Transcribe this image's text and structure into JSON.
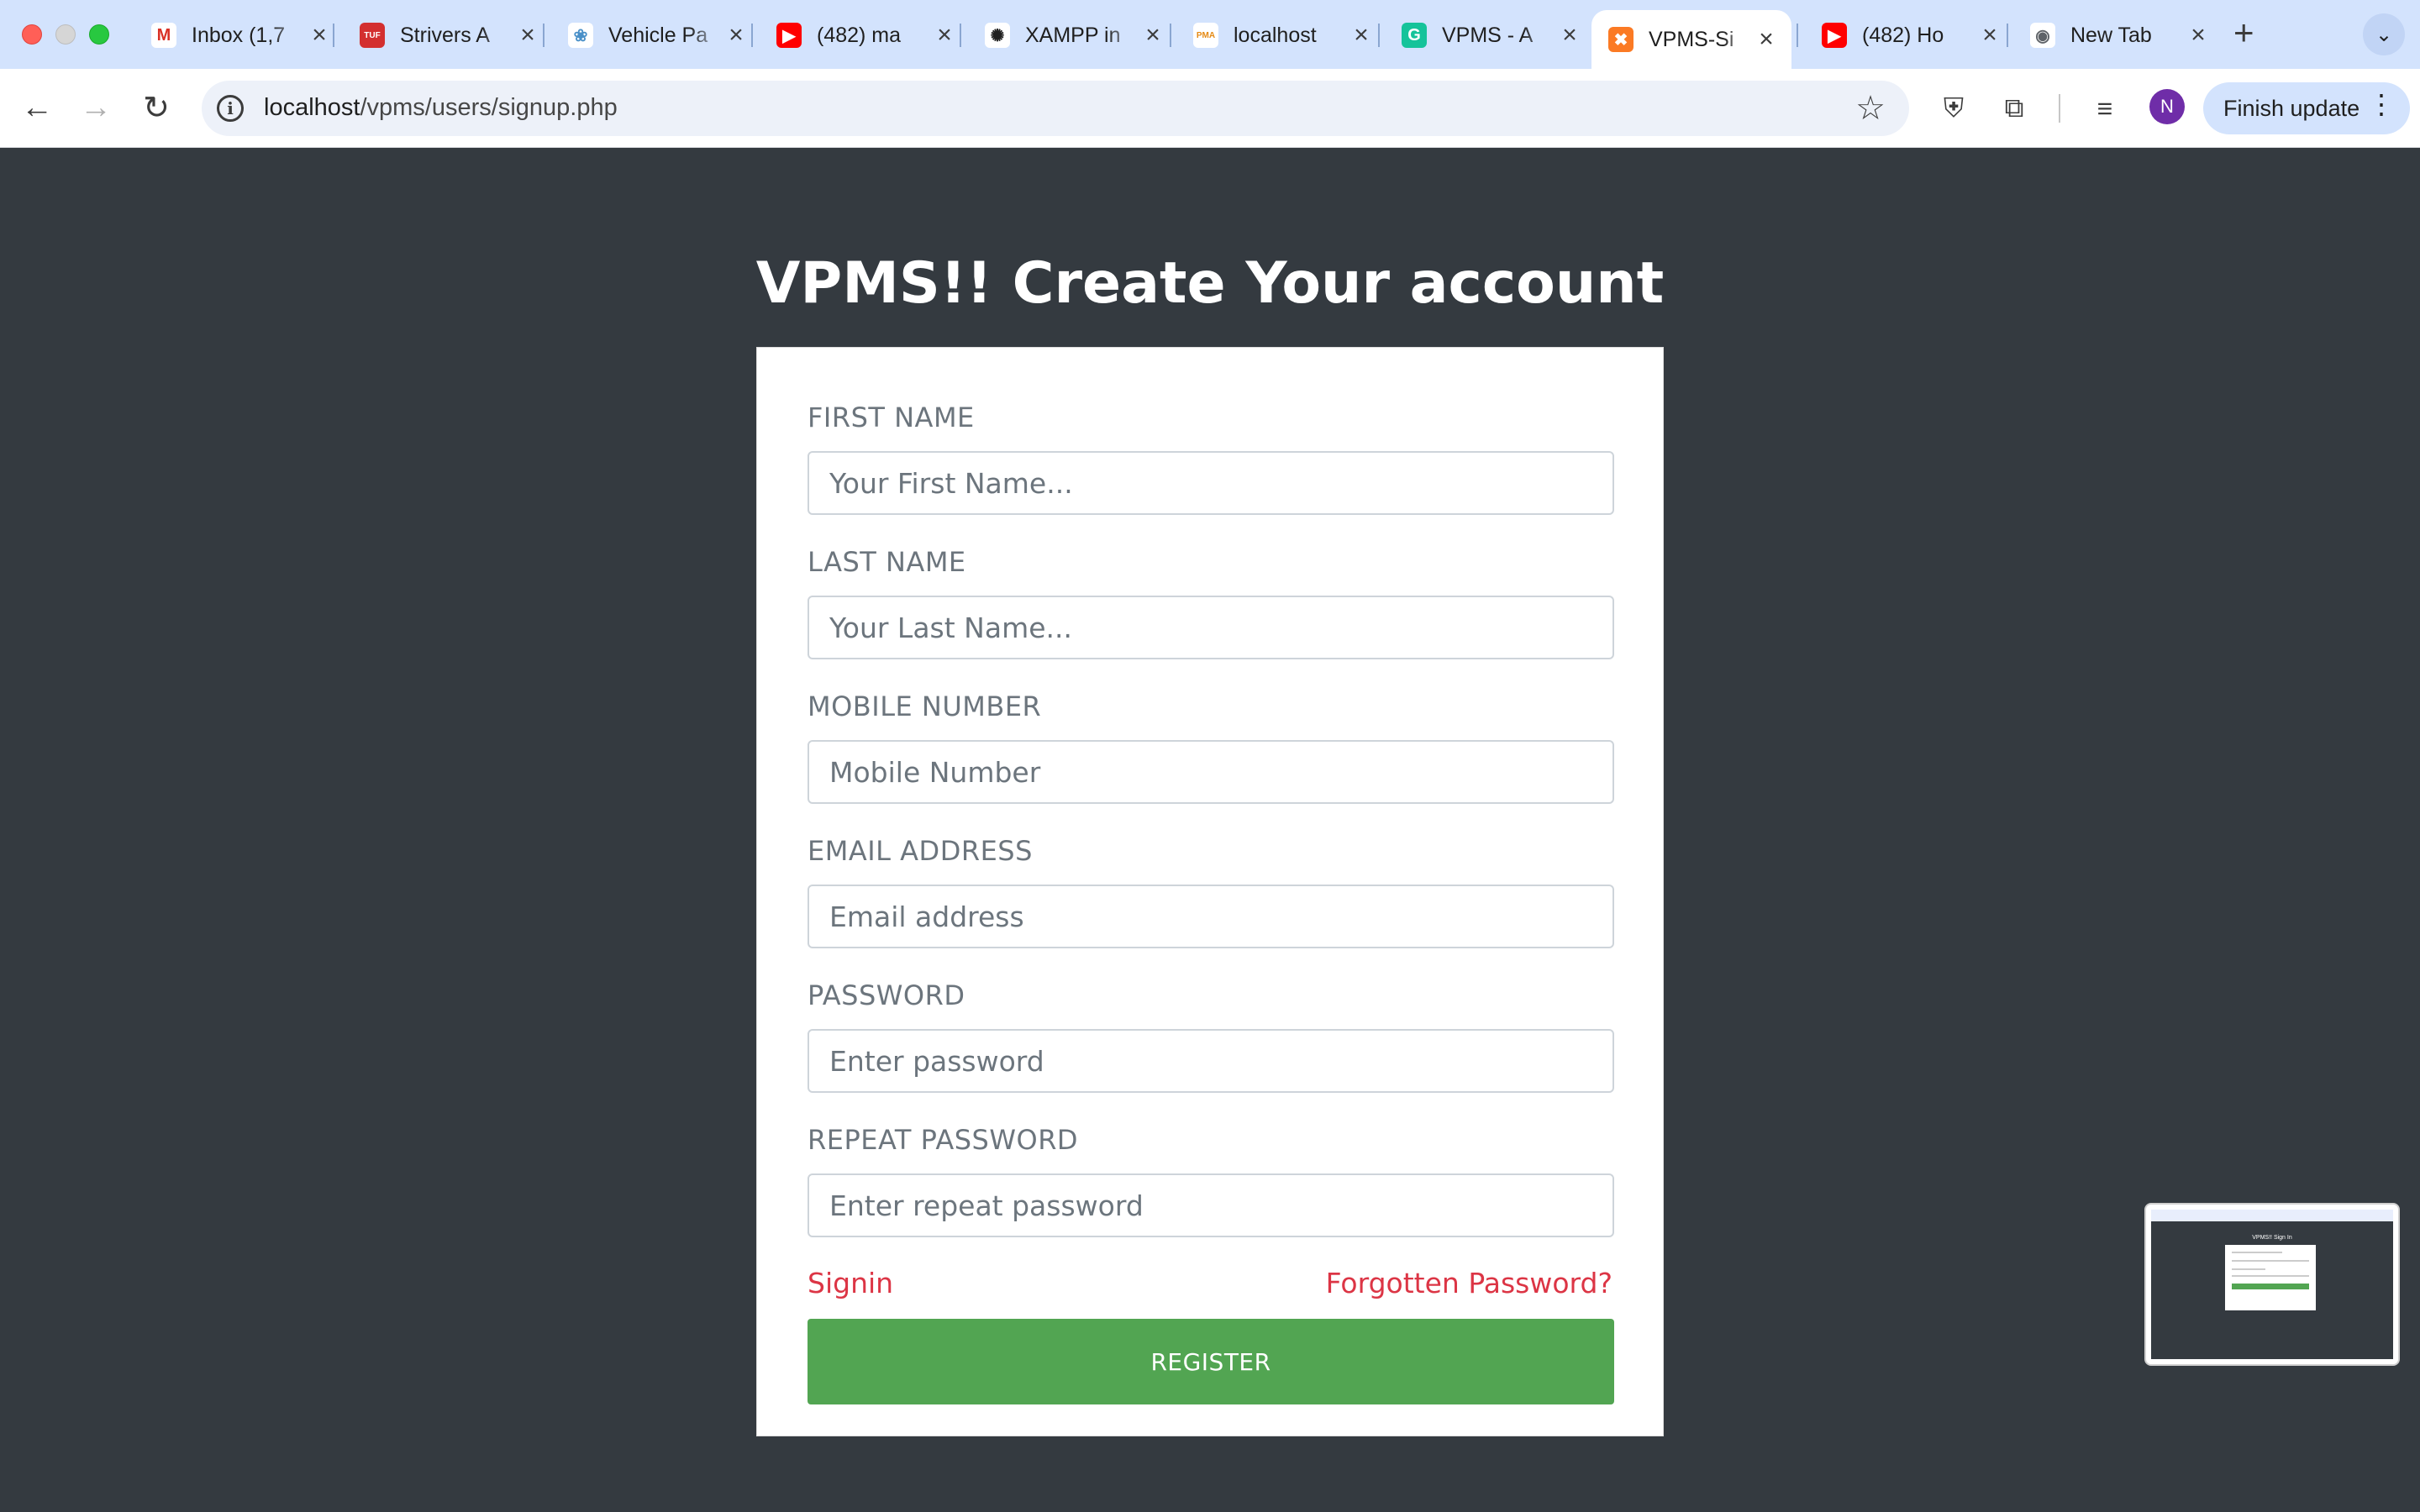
{
  "browser": {
    "tabs": [
      {
        "title": "Inbox (1,7",
        "favicon": "gmail-icon",
        "fav_color": "#ffffff",
        "fav_glyph": "M",
        "glyph_color": "#d93025"
      },
      {
        "title": "Strivers A",
        "favicon": "tuf-icon",
        "fav_color": "#d32f2f",
        "fav_glyph": "TUF",
        "glyph_color": "#ffffff"
      },
      {
        "title": "Vehicle Pa",
        "favicon": "vehicle-icon",
        "fav_color": "#ffffff",
        "fav_glyph": "❀",
        "glyph_color": "#4a90c8"
      },
      {
        "title": "(482) ma",
        "favicon": "youtube-icon",
        "fav_color": "#ff0000",
        "fav_glyph": "▶",
        "glyph_color": "#ffffff"
      },
      {
        "title": "XAMPP in",
        "favicon": "chatgpt-icon",
        "fav_color": "#ffffff",
        "fav_glyph": "✺",
        "glyph_color": "#202020"
      },
      {
        "title": "localhost",
        "favicon": "phpmyadmin-icon",
        "fav_color": "#ffffff",
        "fav_glyph": "PMA",
        "glyph_color": "#e58a14"
      },
      {
        "title": "VPMS - A",
        "favicon": "grammarly-icon",
        "fav_color": "#15c39a",
        "fav_glyph": "G",
        "glyph_color": "#ffffff"
      },
      {
        "title": "VPMS-Si",
        "favicon": "xampp-icon",
        "fav_color": "#fb7a24",
        "fav_glyph": "✖",
        "glyph_color": "#ffffff",
        "active": true
      },
      {
        "title": "(482) Ho",
        "favicon": "youtube-icon",
        "fav_color": "#ff0000",
        "fav_glyph": "▶",
        "glyph_color": "#ffffff"
      },
      {
        "title": "New Tab",
        "favicon": "chrome-icon",
        "fav_color": "#ffffff",
        "fav_glyph": "◉",
        "glyph_color": "#5f6368"
      }
    ],
    "url_host": "localhost",
    "url_path": "/vpms/users/signup.php",
    "profile_initial": "N",
    "finish_update_label": "Finish update"
  },
  "page": {
    "title": "VPMS!! Create Your account",
    "fields": [
      {
        "label": "FIRST NAME",
        "placeholder": "Your First Name...",
        "value": ""
      },
      {
        "label": "LAST NAME",
        "placeholder": "Your Last Name...",
        "value": ""
      },
      {
        "label": "MOBILE NUMBER",
        "placeholder": "Mobile Number",
        "value": ""
      },
      {
        "label": "EMAIL ADDRESS",
        "placeholder": "Email address",
        "value": ""
      },
      {
        "label": "PASSWORD",
        "placeholder": "Enter password",
        "value": ""
      },
      {
        "label": "REPEAT PASSWORD",
        "placeholder": "Enter repeat password",
        "value": ""
      }
    ],
    "signin_label": "Signin",
    "forgot_label": "Forgotten Password?",
    "register_label": "REGISTER",
    "thumbnail_title": "VPMS!! Sign In"
  },
  "colors": {
    "page_bg": "#343a40",
    "register_bg": "#52a552",
    "link": "#dc3545"
  }
}
